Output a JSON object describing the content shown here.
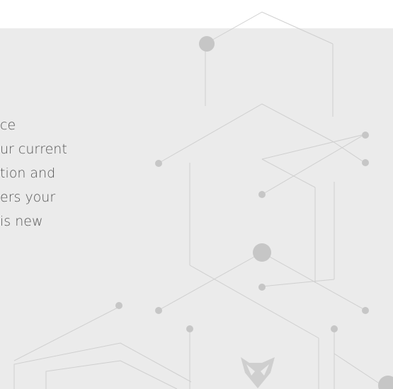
{
  "body_text_lines": [
    "ce",
    "ur current",
    "tion and",
    "ers your",
    "is new"
  ],
  "colors": {
    "page_background": "#ffffff",
    "panel_background": "#ebebeb",
    "line": "#cfcfcf",
    "node": "#c6c6c6",
    "text": "#555555",
    "logo": "#cfcfcf"
  },
  "icons": {
    "logo": "owl-logo-icon"
  }
}
